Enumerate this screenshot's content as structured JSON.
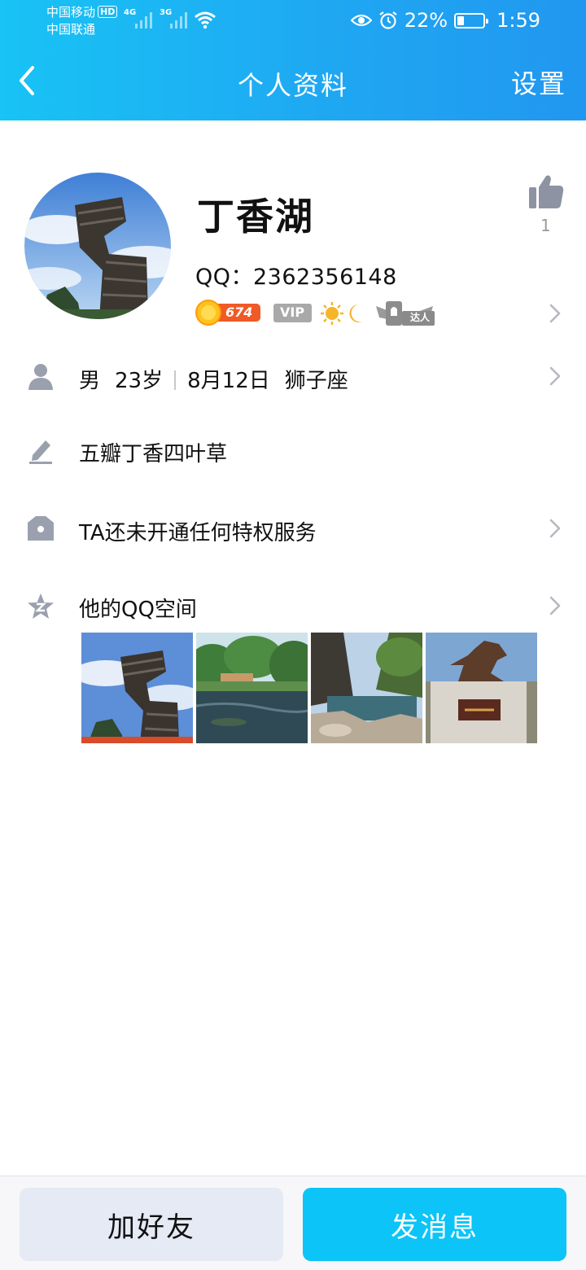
{
  "status_bar": {
    "carrier1": "中国移动",
    "hd": "HD",
    "carrier2": "中国联通",
    "net1": "4G",
    "net2": "3G",
    "battery": "22%",
    "time": "1:59"
  },
  "navbar": {
    "title": "个人资料",
    "settings": "设置"
  },
  "profile": {
    "name": "丁香湖",
    "qq": "QQ：2362356148",
    "level_badge": "674",
    "vip_badge": "VIP",
    "talent_badge": "达人",
    "like_count": "1"
  },
  "rows": {
    "gender": "男",
    "age": "23岁",
    "birthday": "8月12日",
    "zodiac": "狮子座",
    "signature": "五瓣丁香四叶草",
    "privilege": "TA还未开通任何特权服务",
    "qzone": "他的QQ空间"
  },
  "actions": {
    "add_friend": "加好友",
    "send_message": "发消息"
  },
  "colors": {
    "header_start": "#18c3f5",
    "header_end": "#2197f0",
    "primary_button": "#0cc4f8",
    "secondary_button": "#e6eaf4",
    "icon_gray": "#9aa0ae"
  }
}
